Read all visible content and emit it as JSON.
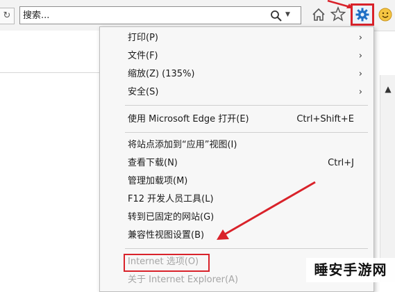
{
  "toolbar": {
    "search_placeholder": "搜索...",
    "search_icon": "search-icon",
    "refresh_icon": "refresh-icon",
    "home_icon": "home-icon",
    "favorites_icon": "star-icon",
    "tools_icon": "gear-icon",
    "feedback_icon": "smiley-icon"
  },
  "menu": {
    "items": [
      {
        "label": "打印(P)",
        "shortcut": "",
        "submenu": true
      },
      {
        "label": "文件(F)",
        "shortcut": "",
        "submenu": true
      },
      {
        "label": "缩放(Z) (135%)",
        "shortcut": "",
        "submenu": true
      },
      {
        "label": "安全(S)",
        "shortcut": "",
        "submenu": true
      },
      {
        "label": "使用 Microsoft Edge 打开(E)",
        "shortcut": "Ctrl+Shift+E",
        "submenu": false
      },
      {
        "label": "将站点添加到“应用”视图(I)",
        "shortcut": "",
        "submenu": false
      },
      {
        "label": "查看下载(N)",
        "shortcut": "Ctrl+J",
        "submenu": false
      },
      {
        "label": "管理加载项(M)",
        "shortcut": "",
        "submenu": false
      },
      {
        "label": "F12 开发人员工具(L)",
        "shortcut": "",
        "submenu": false
      },
      {
        "label": "转到已固定的网站(G)",
        "shortcut": "",
        "submenu": false
      },
      {
        "label": "兼容性视图设置(B)",
        "shortcut": "",
        "submenu": false
      },
      {
        "label": "Internet 选项(O)",
        "shortcut": "",
        "submenu": false
      },
      {
        "label": "关于 Internet Explorer(A)",
        "shortcut": "",
        "submenu": false
      }
    ],
    "chevron": "›"
  },
  "watermark": "睡安手游网",
  "colors": {
    "annotation_red": "#d9222a",
    "gear_blue": "#1f6fc5",
    "menu_bg": "#f7f7f7"
  }
}
